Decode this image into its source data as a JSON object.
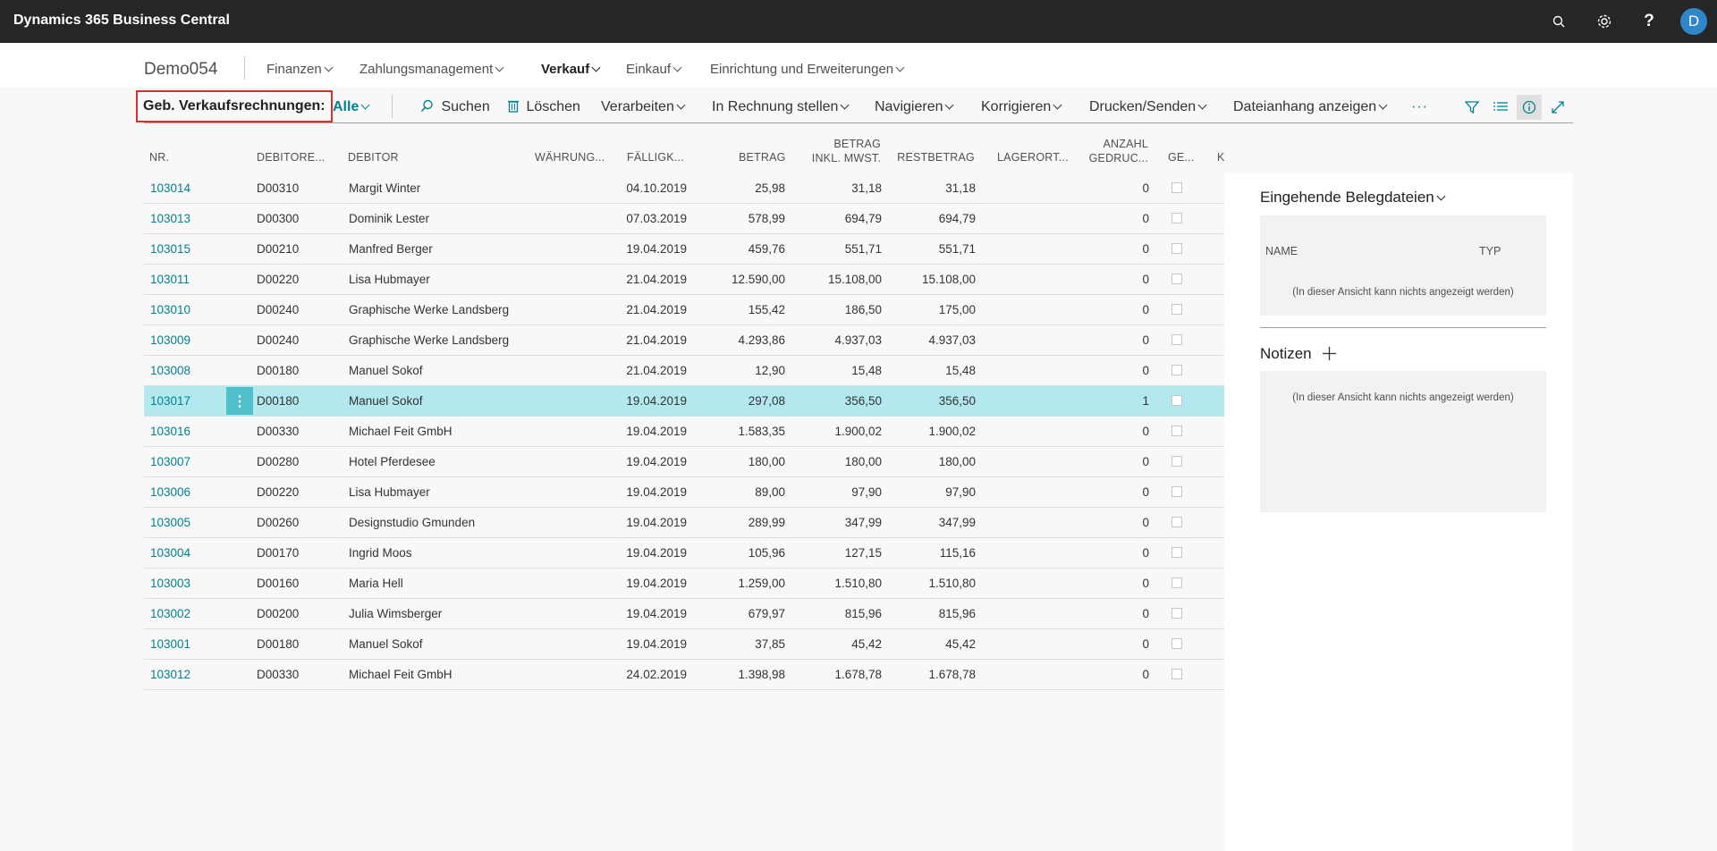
{
  "app": {
    "title": "Dynamics 365 Business Central",
    "user_initial": "D"
  },
  "topbar_icons": [
    "search-icon",
    "gear-icon",
    "help-icon"
  ],
  "nav": {
    "company": "Demo054",
    "items": [
      "Finanzen",
      "Zahlungsmanagement",
      "Verkauf",
      "Einkauf",
      "Einrichtung und Erweiterungen"
    ],
    "active": "Verkauf"
  },
  "actions": {
    "caption": "Geb. Verkaufsrechnungen:",
    "view_filter": "Alle",
    "search": "Suchen",
    "delete": "Löschen",
    "process": "Verarbeiten",
    "invoice": "In Rechnung stellen",
    "navigate": "Navigieren",
    "correct": "Korrigieren",
    "print": "Drucken/Senden",
    "attachment": "Dateianhang anzeigen",
    "more": "···"
  },
  "columns": {
    "nr": "NR.",
    "customer_no": "DEBITORE...",
    "customer": "DEBITOR",
    "currency": "WÄHRUNG...",
    "due": "FÄLLIGK...",
    "amount": "BETRAG",
    "amount_vat_1": "BETRAG",
    "amount_vat_2": "INKL. MWST.",
    "remaining": "RESTBETRAG",
    "location": "LAGERORT...",
    "printed_1": "ANZAHL",
    "printed_2": "GEDRUC...",
    "closed": "GE...",
    "cut": "K"
  },
  "rows": [
    {
      "nr": "103014",
      "cust_no": "D00310",
      "cust": "Margit Winter",
      "due": "04.10.2019",
      "amount": "25,98",
      "amount_vat": "31,18",
      "remaining": "31,18",
      "printed": "0"
    },
    {
      "nr": "103013",
      "cust_no": "D00300",
      "cust": "Dominik Lester",
      "due": "07.03.2019",
      "amount": "578,99",
      "amount_vat": "694,79",
      "remaining": "694,79",
      "printed": "0"
    },
    {
      "nr": "103015",
      "cust_no": "D00210",
      "cust": "Manfred Berger",
      "due": "19.04.2019",
      "amount": "459,76",
      "amount_vat": "551,71",
      "remaining": "551,71",
      "printed": "0"
    },
    {
      "nr": "103011",
      "cust_no": "D00220",
      "cust": "Lisa Hubmayer",
      "due": "21.04.2019",
      "amount": "12.590,00",
      "amount_vat": "15.108,00",
      "remaining": "15.108,00",
      "printed": "0"
    },
    {
      "nr": "103010",
      "cust_no": "D00240",
      "cust": "Graphische Werke Landsberg",
      "due": "21.04.2019",
      "amount": "155,42",
      "amount_vat": "186,50",
      "remaining": "175,00",
      "printed": "0"
    },
    {
      "nr": "103009",
      "cust_no": "D00240",
      "cust": "Graphische Werke Landsberg",
      "due": "21.04.2019",
      "amount": "4.293,86",
      "amount_vat": "4.937,03",
      "remaining": "4.937,03",
      "printed": "0"
    },
    {
      "nr": "103008",
      "cust_no": "D00180",
      "cust": "Manuel Sokof",
      "due": "21.04.2019",
      "amount": "12,90",
      "amount_vat": "15,48",
      "remaining": "15,48",
      "printed": "0"
    },
    {
      "nr": "103017",
      "cust_no": "D00180",
      "cust": "Manuel Sokof",
      "due": "19.04.2019",
      "amount": "297,08",
      "amount_vat": "356,50",
      "remaining": "356,50",
      "printed": "1",
      "selected": true
    },
    {
      "nr": "103016",
      "cust_no": "D00330",
      "cust": "Michael Feit GmbH",
      "due": "19.04.2019",
      "amount": "1.583,35",
      "amount_vat": "1.900,02",
      "remaining": "1.900,02",
      "printed": "0"
    },
    {
      "nr": "103007",
      "cust_no": "D00280",
      "cust": "Hotel Pferdesee",
      "due": "19.04.2019",
      "amount": "180,00",
      "amount_vat": "180,00",
      "remaining": "180,00",
      "printed": "0"
    },
    {
      "nr": "103006",
      "cust_no": "D00220",
      "cust": "Lisa Hubmayer",
      "due": "19.04.2019",
      "amount": "89,00",
      "amount_vat": "97,90",
      "remaining": "97,90",
      "printed": "0"
    },
    {
      "nr": "103005",
      "cust_no": "D00260",
      "cust": "Designstudio Gmunden",
      "due": "19.04.2019",
      "amount": "289,99",
      "amount_vat": "347,99",
      "remaining": "347,99",
      "printed": "0"
    },
    {
      "nr": "103004",
      "cust_no": "D00170",
      "cust": "Ingrid Moos",
      "due": "19.04.2019",
      "amount": "105,96",
      "amount_vat": "127,15",
      "remaining": "115,16",
      "printed": "0"
    },
    {
      "nr": "103003",
      "cust_no": "D00160",
      "cust": "Maria Hell",
      "due": "19.04.2019",
      "amount": "1.259,00",
      "amount_vat": "1.510,80",
      "remaining": "1.510,80",
      "printed": "0"
    },
    {
      "nr": "103002",
      "cust_no": "D00200",
      "cust": "Julia Wimsberger",
      "due": "19.04.2019",
      "amount": "679,97",
      "amount_vat": "815,96",
      "remaining": "815,96",
      "printed": "0"
    },
    {
      "nr": "103001",
      "cust_no": "D00180",
      "cust": "Manuel Sokof",
      "due": "19.04.2019",
      "amount": "37,85",
      "amount_vat": "45,42",
      "remaining": "45,42",
      "printed": "0"
    },
    {
      "nr": "103012",
      "cust_no": "D00330",
      "cust": "Michael Feit GmbH",
      "due": "24.02.2019",
      "amount": "1.398,98",
      "amount_vat": "1.678,78",
      "remaining": "1.678,78",
      "printed": "0"
    }
  ],
  "factbox": {
    "incoming": {
      "title": "Eingehende Belegdateien",
      "col_name": "NAME",
      "col_type": "TYP",
      "empty": "(In dieser Ansicht kann nichts angezeigt werden)"
    },
    "notes": {
      "title": "Notizen",
      "empty": "(In dieser Ansicht kann nichts angezeigt werden)"
    }
  },
  "colors": {
    "accent": "#00838f",
    "selected_row": "#b2e8ee",
    "topbar": "#262626",
    "caption_highlight": "#d32f2f"
  }
}
